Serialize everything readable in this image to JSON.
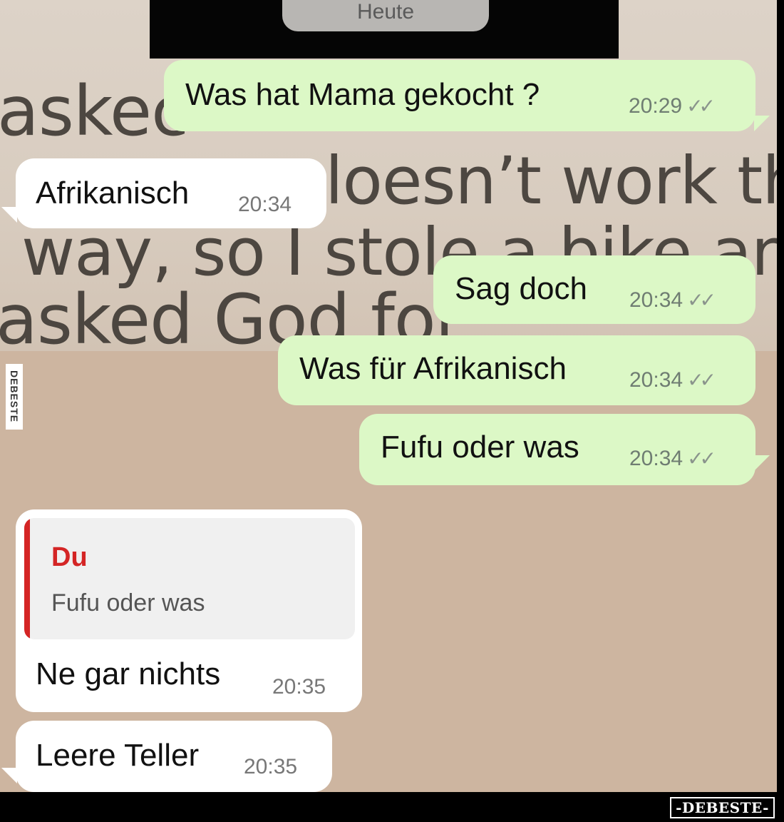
{
  "wallpaper": {
    "lines": [
      "askec",
      "loesn’t work that",
      "way, so I stole a bike and",
      "asked God for"
    ]
  },
  "date_pill": "Heute",
  "messages": [
    {
      "text": "Was hat Mama gekocht ?",
      "time": "20:29",
      "ticks": "✓✓"
    },
    {
      "text": "Afrikanisch",
      "time": "20:34"
    },
    {
      "text": "Sag doch",
      "time": "20:34",
      "ticks": "✓✓"
    },
    {
      "text": "Was für Afrikanisch",
      "time": "20:34",
      "ticks": "✓✓"
    },
    {
      "text": "Fufu oder was",
      "time": "20:34",
      "ticks": "✓✓"
    },
    {
      "text": "Ne gar nichts",
      "time": "20:35",
      "quote": {
        "author": "Du",
        "text": "Fufu oder was"
      }
    },
    {
      "text": "Leere Teller",
      "time": "20:35"
    }
  ],
  "colors": {
    "outgoing_bubble": "#dcf8c6",
    "incoming_bubble": "#ffffff",
    "chat_background": "#cdb5a0",
    "quote_accent": "#d42525"
  },
  "watermarks": {
    "side": "DEBESTE",
    "bottom": "-DEBESTE-"
  }
}
